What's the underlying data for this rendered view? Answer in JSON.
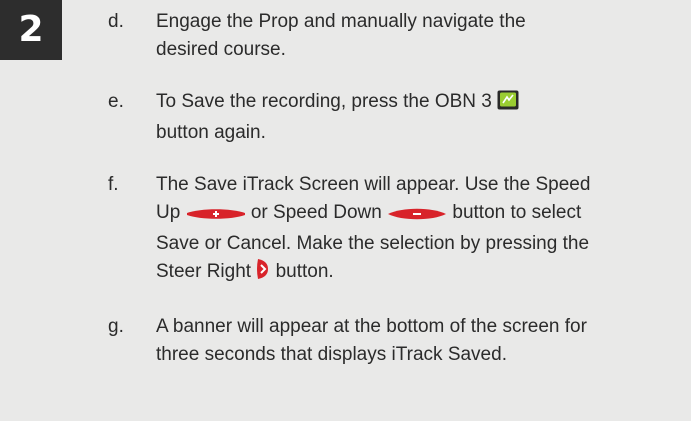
{
  "section_number": "2",
  "steps": [
    {
      "letter": "d.",
      "lines": [
        "Engage the Prop and manually navigate the",
        "desired course."
      ]
    },
    {
      "letter": "e.",
      "line1": "To Save the recording, press the OBN 3",
      "line2": "button again."
    },
    {
      "letter": "f.",
      "line1": "The Save iTrack Screen will appear. Use the Speed",
      "l2a": "Up",
      "l2b": "or Speed Down",
      "l2c": "button to select",
      "line3": "Save or Cancel. Make the selection by pressing the",
      "l4a": "Steer Right",
      "l4b": "button."
    },
    {
      "letter": "g.",
      "lines": [
        "A banner will appear at the bottom of the screen for",
        "three seconds that displays iTrack Saved."
      ]
    }
  ],
  "icons": {
    "obn3": "obn3-button-icon",
    "speed_up": "speed-up-button-icon",
    "speed_down": "speed-down-button-icon",
    "steer_right": "steer-right-button-icon"
  },
  "colors": {
    "badge": "#2d2d2d",
    "speed_buttons": "#d8232a",
    "obn_green": "#9acd32"
  }
}
